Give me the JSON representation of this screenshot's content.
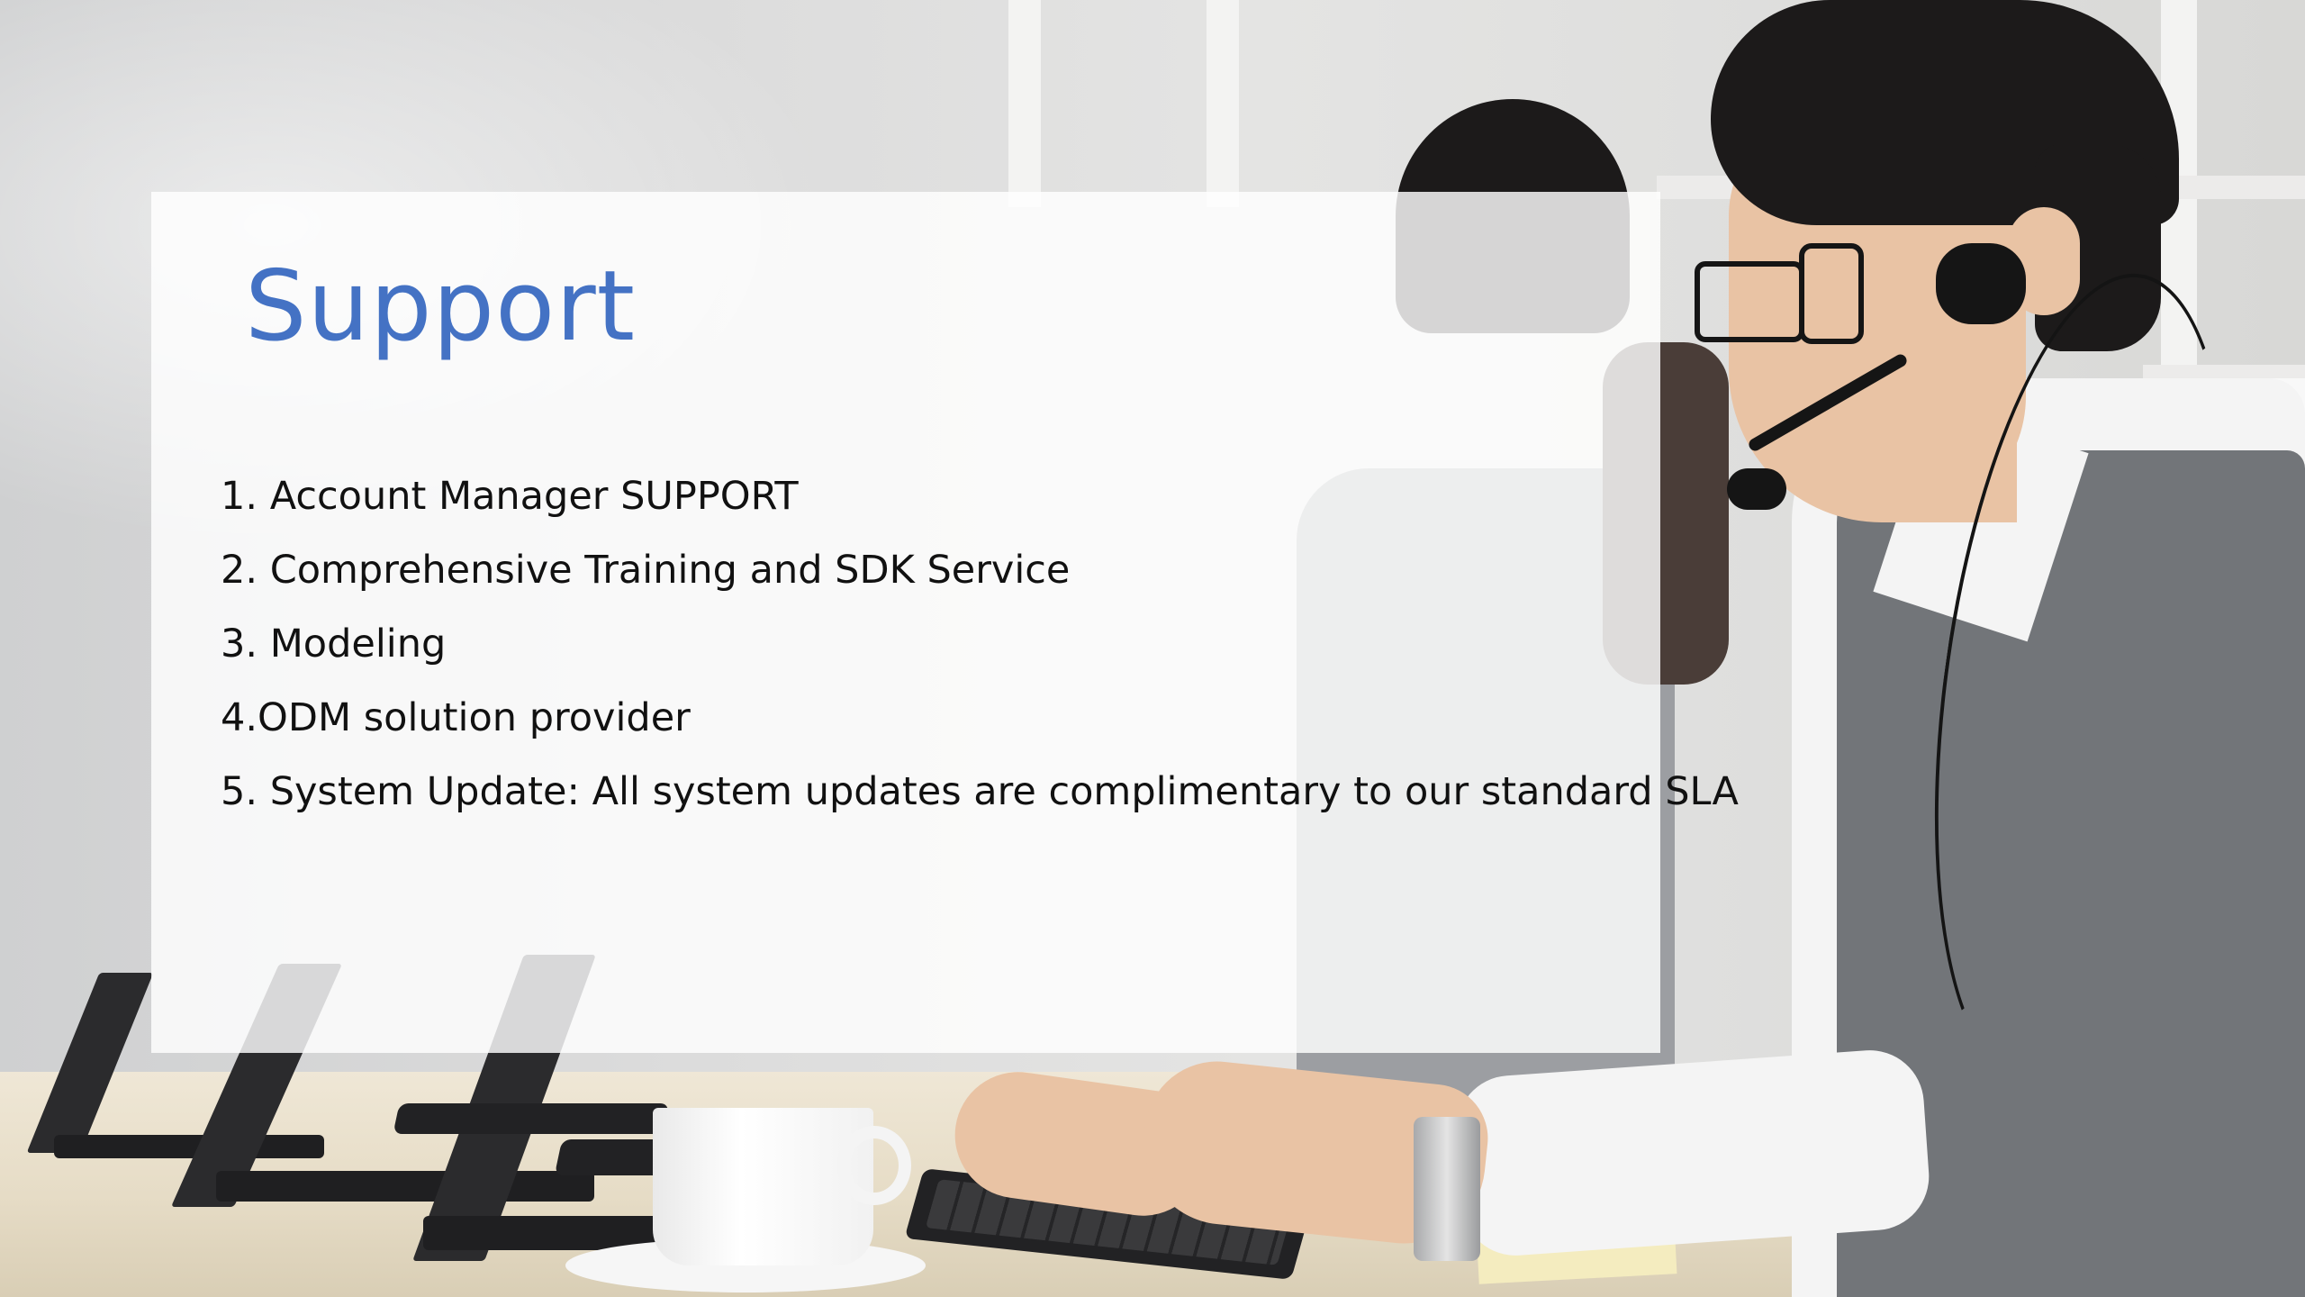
{
  "slide": {
    "title": "Support",
    "items": [
      "1. Account Manager SUPPORT",
      "2. Comprehensive Training and SDK Service",
      "3. Modeling",
      "4.ODM solution provider",
      "5. System Update: All system updates are complimentary to our standard SLA"
    ]
  },
  "colors": {
    "title": "#4472c4",
    "body_text": "#111111",
    "panel": "rgba(255,255,255,0.82)"
  }
}
